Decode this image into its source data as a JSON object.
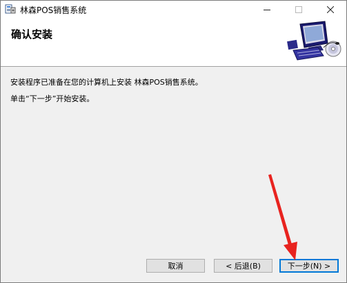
{
  "window": {
    "title": "林森POS销售系统"
  },
  "title_buttons": {
    "minimize": "—",
    "maximize": "☐",
    "close": "✕"
  },
  "banner": {
    "title": "确认安装"
  },
  "body": {
    "line1": "安装程序已准备在您的计算机上安装 林森POS销售系统。",
    "line2": "单击“下一步”开始安装。"
  },
  "buttons": {
    "cancel": "取消",
    "back": "< 后退(B)",
    "next": "下一步(N) >"
  },
  "colors": {
    "accent": "#0078d7",
    "annotation": "#e8231f",
    "body_bg": "#f0f0f0"
  }
}
